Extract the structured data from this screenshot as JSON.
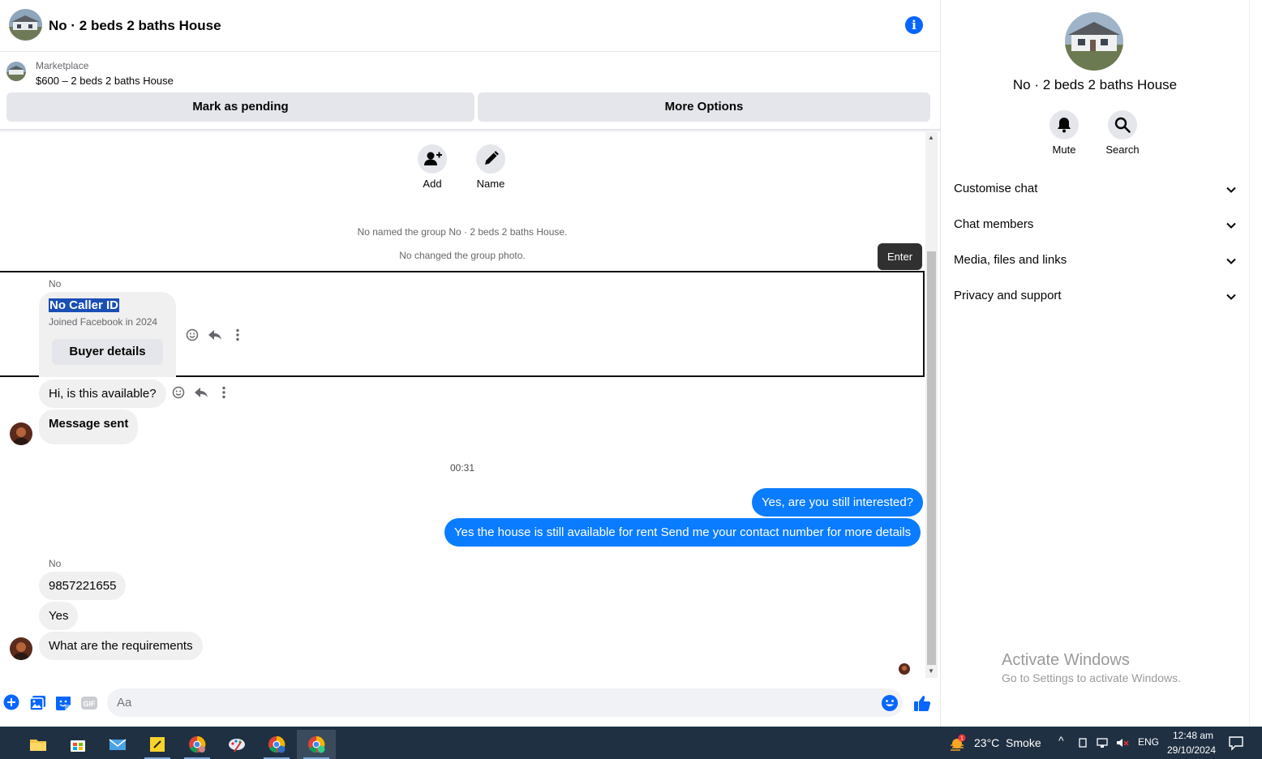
{
  "header": {
    "title": "No · 2 beds 2 baths House"
  },
  "marketplace": {
    "label": "Marketplace",
    "item": "$600 – 2 beds 2 baths House",
    "mark_pending": "Mark as pending",
    "more_options": "More Options"
  },
  "group_actions": {
    "add": "Add",
    "name": "Name"
  },
  "system_messages": [
    "No named the group No · 2 beds 2 baths House.",
    "No changed the group photo."
  ],
  "tooltip": "Enter",
  "caller_card": {
    "sender": "No",
    "name": "No Caller ID",
    "joined": "Joined Facebook in 2024",
    "button": "Buyer details"
  },
  "messages_in_1": [
    "Hi, is this available?",
    "Message sent"
  ],
  "timestamp": "00:31",
  "messages_out": [
    "Yes, are you still interested?",
    "Yes the house is still available for rent Send me your contact number for more details"
  ],
  "second_sender": "No",
  "messages_in_2": [
    "9857221655",
    "Yes",
    "What are the requirements"
  ],
  "composer": {
    "placeholder": "Aa"
  },
  "right_panel": {
    "title": "No · 2 beds 2 baths House",
    "mute": "Mute",
    "search": "Search",
    "sections": [
      "Customise chat",
      "Chat members",
      "Media, files and links",
      "Privacy and support"
    ]
  },
  "activate_windows": {
    "title": "Activate Windows",
    "subtitle": "Go to Settings to activate Windows."
  },
  "taskbar": {
    "weather": "23°C  Smoke",
    "weather_badge": "1",
    "language": "ENG",
    "time": "12:48 am",
    "date": "29/10/2024"
  },
  "colors": {
    "messenger_blue": "#0a7cff",
    "accent": "#0866ff",
    "taskbar": "#1f3043"
  }
}
